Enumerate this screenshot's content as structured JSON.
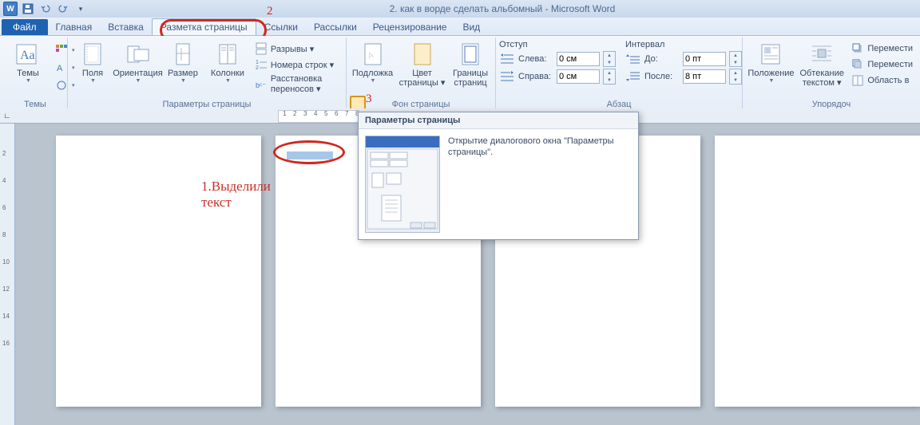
{
  "title": "2. как в ворде сделать альбомный  -  Microsoft Word",
  "tabs": {
    "file": "Файл",
    "home": "Главная",
    "insert": "Вставка",
    "layout": "Разметка страницы",
    "refs": "Ссылки",
    "mail": "Рассылки",
    "review": "Рецензирование",
    "view": "Вид"
  },
  "groups": {
    "themes": {
      "label": "Темы",
      "themes": "Темы"
    },
    "page_setup": {
      "label": "Параметры страницы",
      "margins": "Поля",
      "orientation": "Ориентация",
      "size": "Размер",
      "columns": "Колонки",
      "breaks": "Разрывы ▾",
      "line_numbers": "Номера строк ▾",
      "hyphenation": "Расстановка переносов ▾"
    },
    "page_bg": {
      "label": "Фон страницы",
      "watermark": "Подложка",
      "page_color": "Цвет\nстраницы ▾",
      "borders": "Границы\nстраниц"
    },
    "paragraph": {
      "label": "Абзац",
      "indent": "Отступ",
      "spacing": "Интервал",
      "left": "Слева:",
      "right": "Справа:",
      "before": "До:",
      "after": "После:",
      "left_val": "0 см",
      "right_val": "0 см",
      "before_val": "0 пт",
      "after_val": "8 пт"
    },
    "arrange": {
      "label": "Упорядоч",
      "position": "Положение",
      "wrap": "Обтекание\nтекстом ▾",
      "move1": "Перемести",
      "move2": "Перемести",
      "area": "Область в"
    }
  },
  "tooltip": {
    "title": "Параметры страницы",
    "desc": "Открытие диалогового окна \"Параметры страницы\"."
  },
  "annotations": {
    "num2": "2",
    "num3": "3",
    "sel_text": "1.Выделили\nтекст"
  },
  "ruler_h": [
    "1",
    "2",
    "3",
    "4",
    "5",
    "6",
    "7",
    "8"
  ],
  "ruler_v": [
    "2",
    "4",
    "6",
    "8",
    "10",
    "12",
    "14",
    "16"
  ]
}
